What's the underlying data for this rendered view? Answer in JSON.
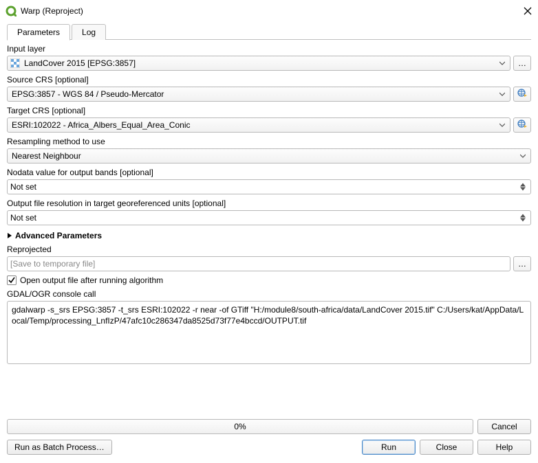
{
  "window": {
    "title": "Warp (Reproject)"
  },
  "tabs": {
    "parameters": "Parameters",
    "log": "Log"
  },
  "labels": {
    "input_layer": "Input layer",
    "source_crs": "Source CRS [optional]",
    "target_crs": "Target CRS [optional]",
    "resampling": "Resampling method to use",
    "nodata": "Nodata value for output bands [optional]",
    "output_res": "Output file resolution in target georeferenced units [optional]",
    "advanced": "Advanced Parameters",
    "reprojected": "Reprojected",
    "open_output": "Open output file after running algorithm",
    "console": "GDAL/OGR console call"
  },
  "values": {
    "input_layer": "LandCover 2015 [EPSG:3857]",
    "source_crs": "EPSG:3857 - WGS 84 / Pseudo-Mercator",
    "target_crs": "ESRI:102022 - Africa_Albers_Equal_Area_Conic",
    "resampling": "Nearest Neighbour",
    "nodata": "Not set",
    "output_res": "Not set",
    "output_path_placeholder": "[Save to temporary file]",
    "open_output_checked": true,
    "console": "gdalwarp -s_srs EPSG:3857 -t_srs ESRI:102022 -r near -of GTiff \"H:/module8/south-africa/data/LandCover 2015.tif\" C:/Users/kat/AppData/Local/Temp/processing_LnfIzP/47afc10c286347da8525d73f77e4bccd/OUTPUT.tif",
    "progress": "0%"
  },
  "buttons": {
    "cancel": "Cancel",
    "batch": "Run as Batch Process…",
    "run": "Run",
    "close": "Close",
    "help": "Help",
    "browse": "…"
  }
}
